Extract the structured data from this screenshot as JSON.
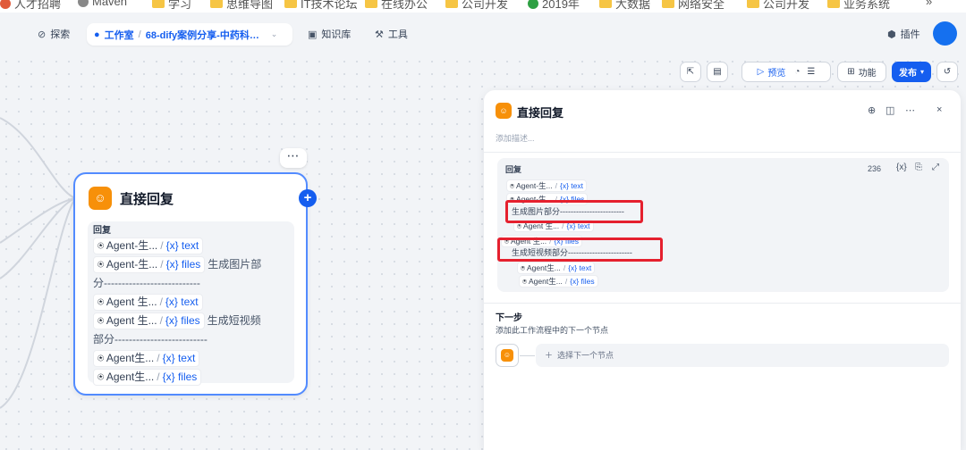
{
  "bookmarks": [
    {
      "label": "人才招聘",
      "icon": "dot",
      "color": "#e05a3a"
    },
    {
      "label": "Maven",
      "icon": "globe-icon",
      "color": "#888888"
    },
    {
      "label": "学习",
      "icon": "folder-icon",
      "color": "#f6c544"
    },
    {
      "label": "思维导图",
      "icon": "folder-icon",
      "color": "#f6c544"
    },
    {
      "label": "IT技术论坛",
      "icon": "folder-icon",
      "color": "#f6c544"
    },
    {
      "label": "在线办公",
      "icon": "folder-icon",
      "color": "#f6c544"
    },
    {
      "label": "公司开发",
      "icon": "folder-icon",
      "color": "#f6c544"
    },
    {
      "label": "2019年",
      "icon": "dot",
      "color": "#2ea043"
    },
    {
      "label": "大数据",
      "icon": "folder-icon",
      "color": "#f6c544"
    },
    {
      "label": "网络安全",
      "icon": "folder-icon",
      "color": "#f6c544"
    },
    {
      "label": "公司开发",
      "icon": "folder-icon",
      "color": "#f6c544"
    },
    {
      "label": "业务系统",
      "icon": "folder-icon",
      "color": "#f6c544"
    },
    {
      "label": "»",
      "icon": "",
      "color": ""
    }
  ],
  "nav": {
    "explore": "探索",
    "studio": "工作室",
    "app_name": "68-dify案例分享-中药科普...",
    "knowledge": "知识库",
    "tools": "工具",
    "plugins": "插件"
  },
  "toolbar": {
    "preview": "预览",
    "features": "功能",
    "publish": "发布"
  },
  "node": {
    "title": "直接回复",
    "reply_label": "回复",
    "lines": [
      {
        "agent": "Agent-生...",
        "var": "{x} text",
        "tail": ""
      },
      {
        "agent": "Agent-生...",
        "var": "{x} files",
        "tail": "生成图片部"
      },
      {
        "agent": "",
        "var": "",
        "tail": "分---------------------------"
      },
      {
        "agent": "Agent 生...",
        "var": "{x} text",
        "tail": ""
      },
      {
        "agent": "Agent 生...",
        "var": "{x} files",
        "tail": "生成短视频"
      },
      {
        "agent": "",
        "var": "",
        "tail": "部分--------------------------"
      },
      {
        "agent": "Agent生...",
        "var": "{x} text",
        "tail": ""
      },
      {
        "agent": "Agent生...",
        "var": "{x} files",
        "tail": ""
      }
    ]
  },
  "panel": {
    "title": "直接回复",
    "description_placeholder": "添加描述...",
    "reply_label": "回复",
    "char_count": "236",
    "lines": [
      {
        "agent": "Agent-生...",
        "var": "{x} text",
        "tail": ""
      },
      {
        "agent": "Agent-生...",
        "var": "{x} files",
        "tail": ""
      },
      {
        "agent": "",
        "var": "",
        "tail": "生成图片部分------------------------"
      },
      {
        "agent": "Agent 生...",
        "var": "{x} text",
        "tail": ""
      },
      {
        "agent": "Agent 生...",
        "var": "{x} files",
        "tail": ""
      },
      {
        "agent": "",
        "var": "",
        "tail": "生成短视频部分------------------------"
      },
      {
        "agent": "Agent生...",
        "var": "{x} text",
        "tail": ""
      },
      {
        "agent": "Agent生...",
        "var": "{x} files",
        "tail": ""
      }
    ],
    "next_title": "下一步",
    "next_desc": "添加此工作流程中的下一个节点",
    "next_select": "选择下一个节点"
  },
  "colors": {
    "primary": "#155eef",
    "node_icon": "#f79009",
    "highlight": "#e5202e"
  }
}
